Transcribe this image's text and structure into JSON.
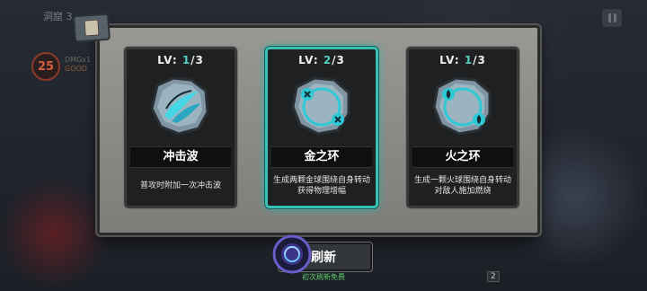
{
  "hud": {
    "top_left_text": "洞窟 3",
    "level": "25",
    "small_label": "DMGx1",
    "small_value": "GOOD",
    "skill_count": "2"
  },
  "colors": {
    "accent": "#52d1c2",
    "selected_border": "#38c0b4",
    "free_text": "#5fcf6d"
  },
  "cards": [
    {
      "level_label": "LV:",
      "level_current": "1",
      "level_max": "/3",
      "icon": "shockwave-icon",
      "name": "冲击波",
      "description_lines": [
        "普攻时附加一次冲击波"
      ]
    },
    {
      "level_label": "LV:",
      "level_current": "2",
      "level_max": "/3",
      "icon": "gold-ring-icon",
      "name": "金之环",
      "description_lines": [
        "生成两颗金球围绕自身转动",
        "获得物理增幅"
      ],
      "selected": true
    },
    {
      "level_label": "LV:",
      "level_current": "1",
      "level_max": "/3",
      "icon": "fire-ring-icon",
      "name": "火之环",
      "description_lines": [
        "生成一颗火球围绕自身转动",
        "对敌人施加燃烧"
      ]
    }
  ],
  "refresh": {
    "label": "刷新",
    "note": "初次刷新免费"
  }
}
